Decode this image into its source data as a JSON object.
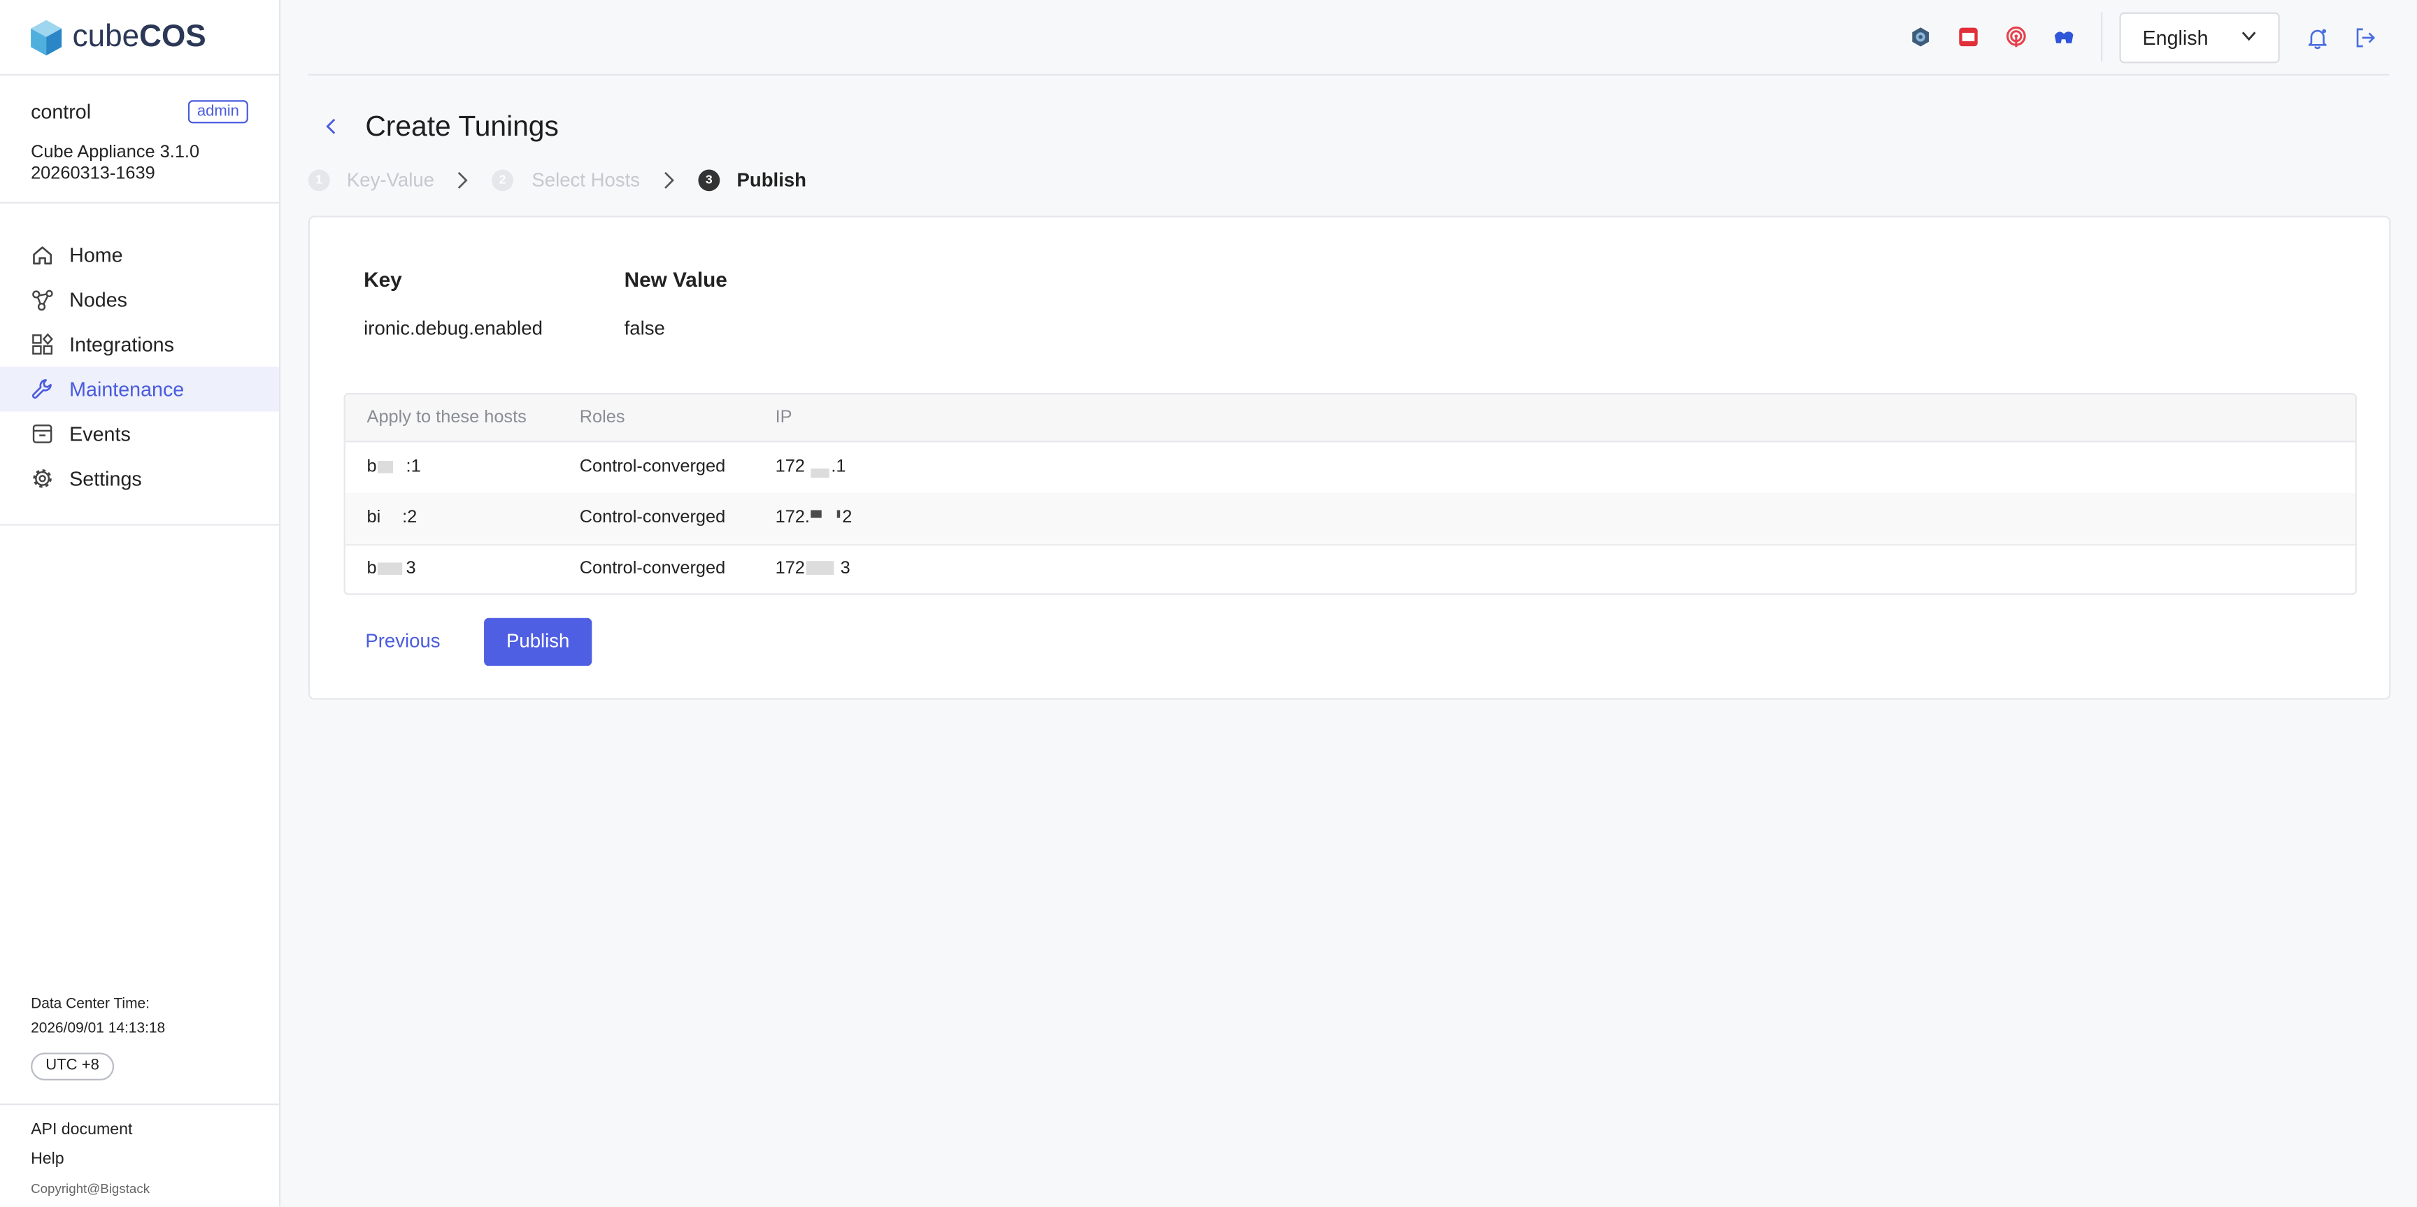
{
  "logo": {
    "text_light": "cube",
    "text_bold": "COS",
    "icon": "cube-logo-icon"
  },
  "sidebar": {
    "user": "control",
    "role_badge": "admin",
    "version": "Cube Appliance 3.1.0",
    "build": "20260313-1639",
    "nav": [
      {
        "label": "Home",
        "icon": "home-icon",
        "active": false
      },
      {
        "label": "Nodes",
        "icon": "nodes-icon",
        "active": false
      },
      {
        "label": "Integrations",
        "icon": "integrations-icon",
        "active": false
      },
      {
        "label": "Maintenance",
        "icon": "wrench-icon",
        "active": true
      },
      {
        "label": "Events",
        "icon": "events-icon",
        "active": false
      },
      {
        "label": "Settings",
        "icon": "gear-icon",
        "active": false
      }
    ],
    "time_label": "Data Center Time:",
    "time_value": "2026/09/01 14:13:18",
    "timezone": "UTC +8",
    "footer": {
      "api": "API document",
      "help": "Help",
      "copyright": "Copyright@Bigstack"
    }
  },
  "header": {
    "icons": [
      "hexagon-dashboard-icon",
      "red-window-icon",
      "broadcast-icon",
      "blue-cloud-icon"
    ],
    "language": "English",
    "notification_icon": "bell-icon",
    "logout_icon": "logout-icon"
  },
  "page": {
    "title": "Create Tunings",
    "steps": [
      {
        "num": "1",
        "label": "Key-Value",
        "active": false
      },
      {
        "num": "2",
        "label": "Select Hosts",
        "active": false
      },
      {
        "num": "3",
        "label": "Publish",
        "active": true
      }
    ]
  },
  "tuning": {
    "key_header": "Key",
    "value_header": "New Value",
    "key": "ironic.debug.enabled",
    "value": "false"
  },
  "hosts_table": {
    "columns": [
      "Apply to these hosts",
      "Roles",
      "IP"
    ],
    "rows": [
      {
        "host_start": "b",
        "host_end": ":1",
        "role": "Control-converged",
        "ip_start": "172",
        "ip_end": ".1"
      },
      {
        "host_start": "bi",
        "host_end": ":2",
        "role": "Control-converged",
        "ip_start": "172.",
        "ip_end": "2"
      },
      {
        "host_start": "b",
        "host_end": "3",
        "role": "Control-converged",
        "ip_start": "172",
        "ip_end": "3"
      }
    ]
  },
  "actions": {
    "previous": "Previous",
    "publish": "Publish"
  },
  "colors": {
    "accent": "#4a5bdc",
    "active_nav_bg": "#eef0fc",
    "publish_button": "#4f5fe3",
    "page_bg": "#f7f8fa",
    "icon_red": "#e0303a",
    "icon_blue": "#2f56d8"
  }
}
